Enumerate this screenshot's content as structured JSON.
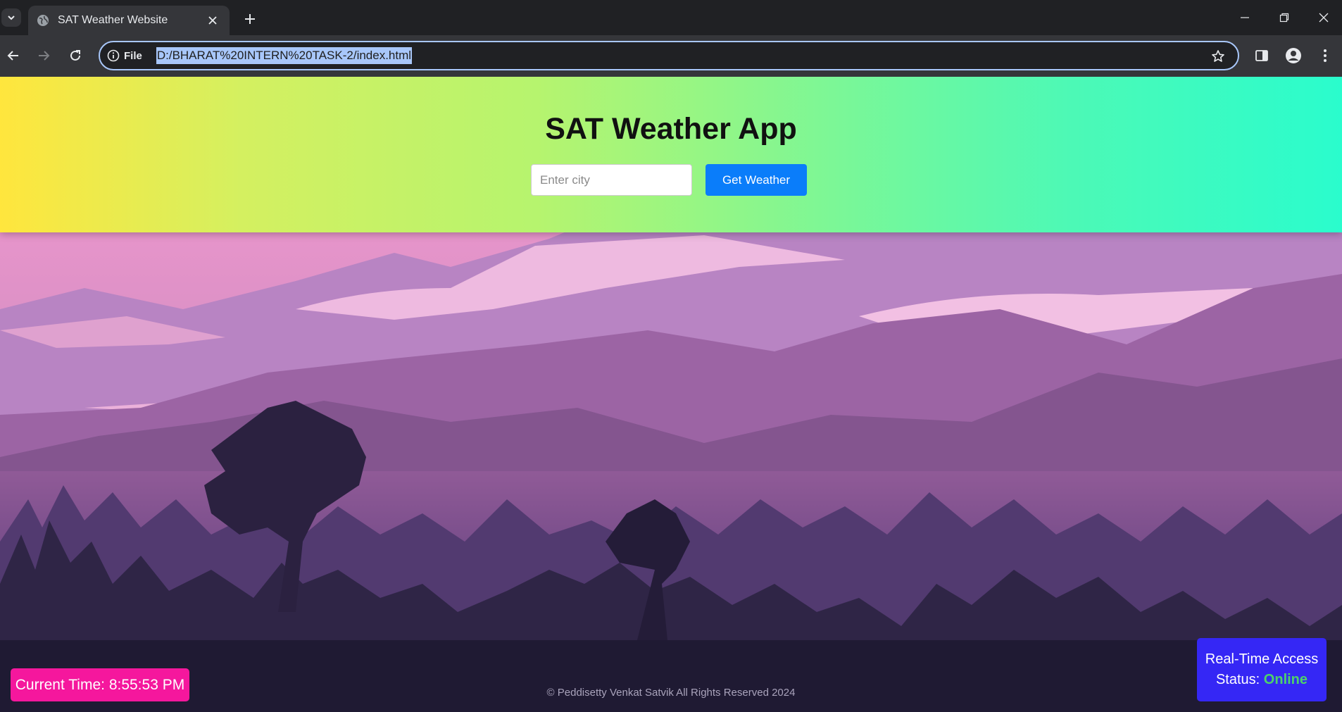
{
  "browser": {
    "tab_title": "SAT Weather Website",
    "omnibox_label": "File",
    "url": "D:/BHARAT%20INTERN%20TASK-2/index.html"
  },
  "app": {
    "title": "SAT Weather App",
    "city_placeholder": "Enter city",
    "city_value": "",
    "get_weather_label": "Get Weather",
    "current_time_label": "Current Time:",
    "current_time_value": "8:55:53 PM",
    "footer_text": "© Peddisetty Venkat Satvik All Rights Reserved 2024",
    "status_title": "Real-Time Access",
    "status_label": "Status:",
    "status_value": "Online"
  },
  "colors": {
    "header_gradient_start": "#ffe63d",
    "header_gradient_end": "#2afccd",
    "button_blue": "#0a7dfa",
    "time_badge_pink": "#f5179d",
    "status_box_blue": "#3527f5",
    "status_online_green": "#4dd26b"
  }
}
